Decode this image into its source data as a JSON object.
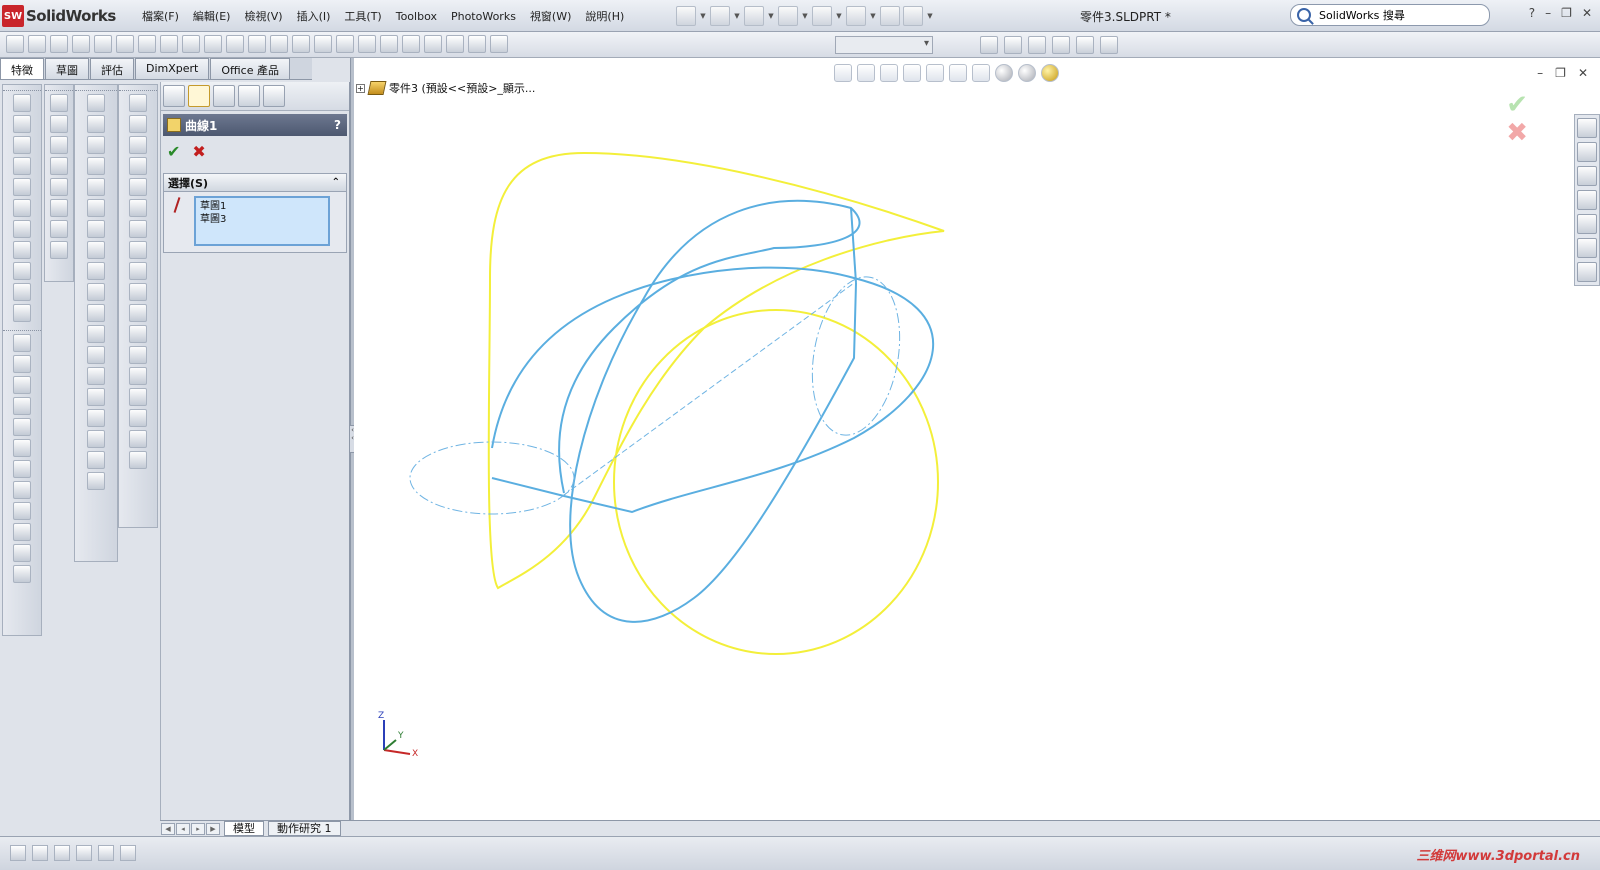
{
  "app": {
    "name": "SolidWorks",
    "logo_text": "SW",
    "document_title": "零件3.SLDPRT *"
  },
  "menu": [
    "檔案(F)",
    "編輯(E)",
    "檢視(V)",
    "插入(I)",
    "工具(T)",
    "Toolbox",
    "PhotoWorks",
    "視窗(W)",
    "說明(H)"
  ],
  "search": {
    "value": "SolidWorks 搜尋"
  },
  "window_controls": {
    "help": "?",
    "minimize": "–",
    "restore": "❐",
    "close": "✕"
  },
  "fm_tabs": [
    {
      "label": "特徵",
      "active": true
    },
    {
      "label": "草圖",
      "active": false
    },
    {
      "label": "評估",
      "active": false
    },
    {
      "label": "DimXpert",
      "active": false
    },
    {
      "label": "Office 產品",
      "active": false
    }
  ],
  "property_manager": {
    "title": "曲線1",
    "help": "?",
    "ok": "✔",
    "cancel": "✖",
    "selection_group": {
      "title": "選擇(S)",
      "collapse": "⌃",
      "items": [
        "草圖1",
        "草圖3"
      ]
    }
  },
  "graphics": {
    "tree_flyout": "零件3 (預設<<預設>_顯示...",
    "expand": "+",
    "viewport_controls": {
      "minimize": "–",
      "restore": "❐",
      "close": "✕"
    },
    "confirm_ok": "✔",
    "confirm_cancel": "✖",
    "triad": {
      "x": "X",
      "y": "Y",
      "z": "Z"
    },
    "colors": {
      "sketch_curve": "#f3ef3a",
      "composite_curve": "#5aaee0",
      "construction": "#6fb4e3"
    }
  },
  "bottom_tabs": [
    {
      "label": "模型",
      "active": true
    },
    {
      "label": "動作研究 1",
      "active": false
    }
  ],
  "status": {
    "watermark": "三维网www.3dportal.cn"
  },
  "icons": {
    "search": "search-icon",
    "ok": "check-icon",
    "cancel": "cross-icon",
    "part": "part-icon",
    "feature": "curve-feature-icon"
  }
}
